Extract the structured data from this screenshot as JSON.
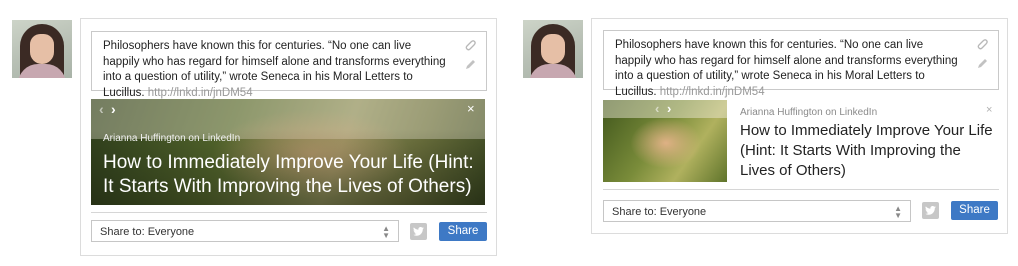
{
  "post": {
    "text": "Philosophers have known this for centuries. “No one can live happily who has regard for himself alone and transforms everything into a question of utility,” wrote Seneca in his Moral Letters to Lucillus.",
    "url": "http://lnkd.in/jnDM54"
  },
  "preview": {
    "source": "Arianna Huffington on LinkedIn",
    "headline": "How to Immediately Improve Your Life (Hint: It Starts With Improving the Lives of Others)",
    "close": "×",
    "prev": "‹",
    "next": "›"
  },
  "share": {
    "visibility": "Share to: Everyone",
    "button": "Share"
  },
  "icons": {
    "attach": "attachment-icon",
    "edit": "pencil-icon",
    "twitter": "twitter-icon",
    "caret": "select-caret-icon"
  },
  "colors": {
    "share_button": "#3e79c5",
    "url": "#999999"
  }
}
